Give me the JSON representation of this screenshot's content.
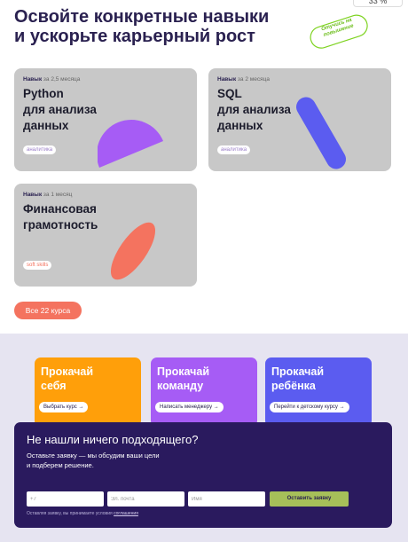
{
  "header": {
    "title_line1": "Освойте конкретные навыки",
    "title_line2": "и ускорьте карьерный рост",
    "sticker": "Отучись на повышение",
    "corner_badge": "33 %"
  },
  "courses": [
    {
      "label": "Навык",
      "duration": "за 2,5 месяца",
      "title": "Python\nдля анализа\nданных",
      "tag": "аналитика"
    },
    {
      "label": "Навык",
      "duration": "за 2 месяца",
      "title": "SQL\nдля анализа\nданных",
      "tag": "аналитика"
    },
    {
      "label": "Навык",
      "duration": "за 1 месяц",
      "title": "Финансовая\nграмотность",
      "tag": "soft skills"
    }
  ],
  "all_courses_button": "Все 22 курса",
  "promos": [
    {
      "title": "Прокачай\nсебя",
      "button": "Выбрать курс →",
      "color": "#ff9f0a"
    },
    {
      "title": "Прокачай\nкоманду",
      "button": "Написать менеджеру →",
      "color": "#a65cf5"
    },
    {
      "title": "Прокачай\nребёнка",
      "button": "Перейти к детскому курсу →",
      "color": "#5b5cf0"
    }
  ],
  "lead_form": {
    "title": "Не нашли ничего подходящего?",
    "description": "Оставьте заявку — мы обсудим ваши цели\nи подберем решение.",
    "phone_placeholder": "+7",
    "email_placeholder": "Эл. почта",
    "name_placeholder": "Имя",
    "submit_label": "Оставить заявку",
    "consent_text": "Оставляя заявку, вы принимаете условия",
    "consent_link": "соглашения"
  },
  "colors": {
    "card_bg": "#c8c8c8",
    "accent_purple": "#a65cf5",
    "accent_blue": "#5b5cf0",
    "accent_coral": "#f4735f",
    "form_bg": "#2a1a5e",
    "submit_bg": "#a6bf59"
  }
}
